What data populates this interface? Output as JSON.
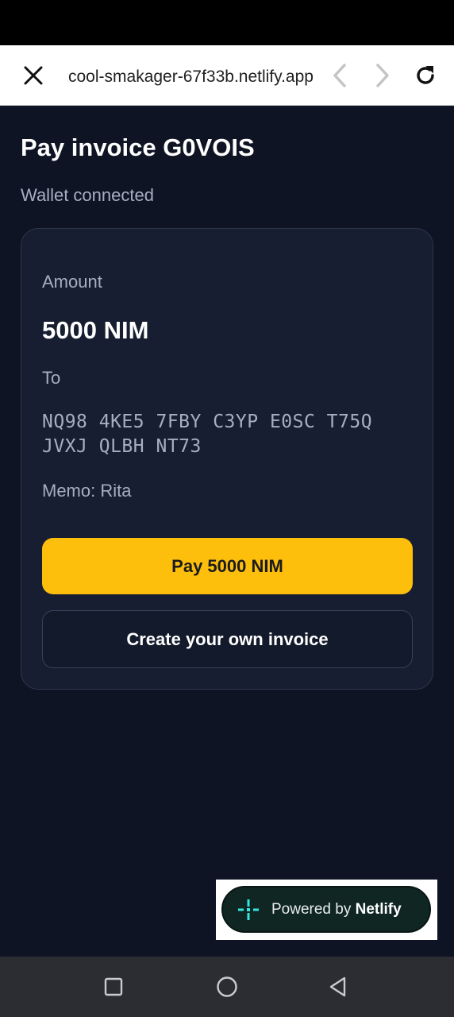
{
  "browser": {
    "url": "cool-smakager-67f33b.netlify.app"
  },
  "page": {
    "title": "Pay invoice G0VOIS",
    "wallet_status": "Wallet connected"
  },
  "invoice": {
    "amount_label": "Amount",
    "amount_value": "5000 NIM",
    "to_label": "To",
    "address_line1": "NQ98 4KE5 7FBY C3YP E0SC T75Q",
    "address_line2": "JVXJ QLBH NT73",
    "memo": "Memo: Rita",
    "pay_button": "Pay 5000 NIM",
    "create_button": "Create your own invoice"
  },
  "badge": {
    "prefix": "Powered by ",
    "brand": "Netlify"
  },
  "colors": {
    "background": "#0f1424",
    "card": "#181e31",
    "accent": "#fdbf0c",
    "muted_text": "#a7aec2",
    "netlify_badge": "#0f2623",
    "netlify_teal": "#32e6e2"
  },
  "icons": [
    "close-icon",
    "chevron-left-icon",
    "chevron-right-icon",
    "reload-icon",
    "netlify-logo-icon",
    "square-icon",
    "circle-icon",
    "triangle-back-icon"
  ]
}
